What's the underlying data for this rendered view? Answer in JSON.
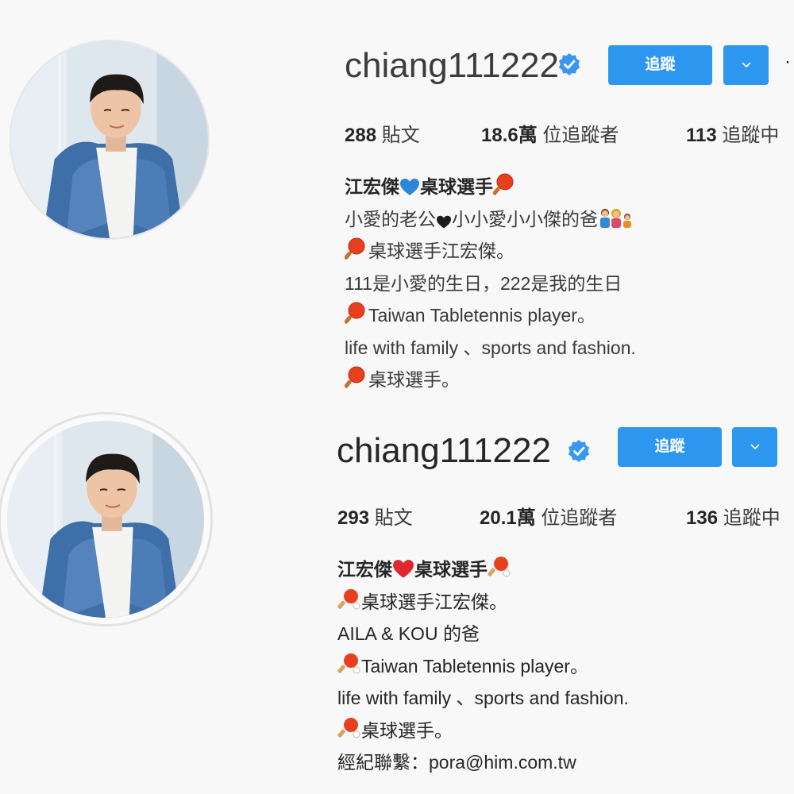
{
  "profile_top": {
    "username": "chiang111222",
    "follow_label": "追蹤",
    "more_glyph": "·",
    "stats": {
      "posts_count": "288",
      "posts_label": "貼文",
      "followers_count": "18.6萬",
      "followers_label": "位追蹤者",
      "following_count": "113",
      "following_label": "追蹤中"
    },
    "bio": {
      "name_a": "江宏傑",
      "name_b": "桌球選手",
      "line2_a": "小愛的老公",
      "line2_b": "小小愛小小傑的爸",
      "line3": "桌球選手江宏傑。",
      "line4": "111是小愛的生日，222是我的生日",
      "line5": "Taiwan Tabletennis player。",
      "line6": "life with family 、sports and fashion.",
      "line7": "桌球選手。"
    }
  },
  "profile_bottom": {
    "username": "chiang111222",
    "follow_label": "追蹤",
    "stats": {
      "posts_count": "293",
      "posts_label": "貼文",
      "followers_count": "20.1萬",
      "followers_label": "位追蹤者",
      "following_count": "136",
      "following_label": "追蹤中"
    },
    "bio": {
      "name_a": "江宏傑",
      "name_b": "桌球選手",
      "line2": "桌球選手江宏傑。",
      "line3": "AILA & KOU 的爸",
      "line4": "Taiwan Tabletennis player。",
      "line5": "life with family 、sports and fashion.",
      "line6": "桌球選手。",
      "line7": "經紀聯繫：pora@him.com.tw"
    }
  },
  "icons": {
    "verified": "verified-badge-icon",
    "dropdown": "chevron-down-icon",
    "paddle": "ping-pong-paddle-icon",
    "blue_heart": "blue-heart-icon",
    "red_heart": "red-heart-icon",
    "black_heart": "black-heart-icon",
    "family": "family-icon"
  },
  "colors": {
    "accent": "#2d97f0",
    "verified": "#3897f0",
    "paddle": "#e8401f",
    "background": "#f8f8f8"
  }
}
